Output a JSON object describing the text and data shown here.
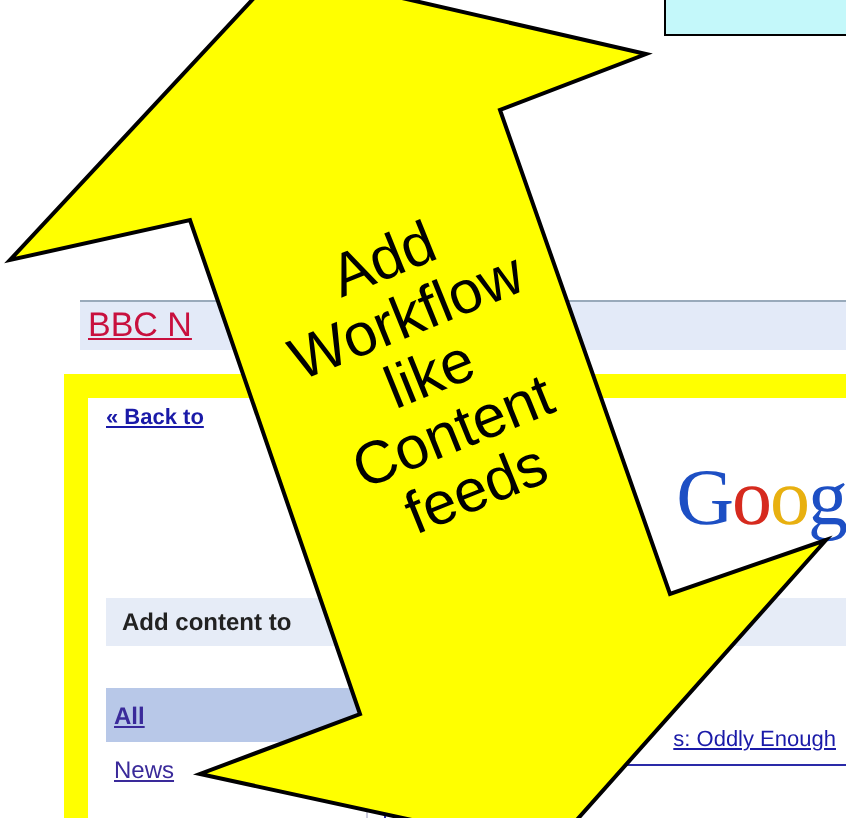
{
  "header": {
    "title": "BBC N"
  },
  "back_link": "« Back to",
  "logo": "Goog",
  "panel": {
    "title": "Add content to"
  },
  "categories": [
    {
      "label": "All",
      "selected": true
    },
    {
      "label": "News",
      "selected": false
    }
  ],
  "feed_link": "s: Oddly Enough",
  "arrow": {
    "lines": [
      "Add",
      "Workflow",
      "like",
      "Content",
      "feeds"
    ]
  }
}
